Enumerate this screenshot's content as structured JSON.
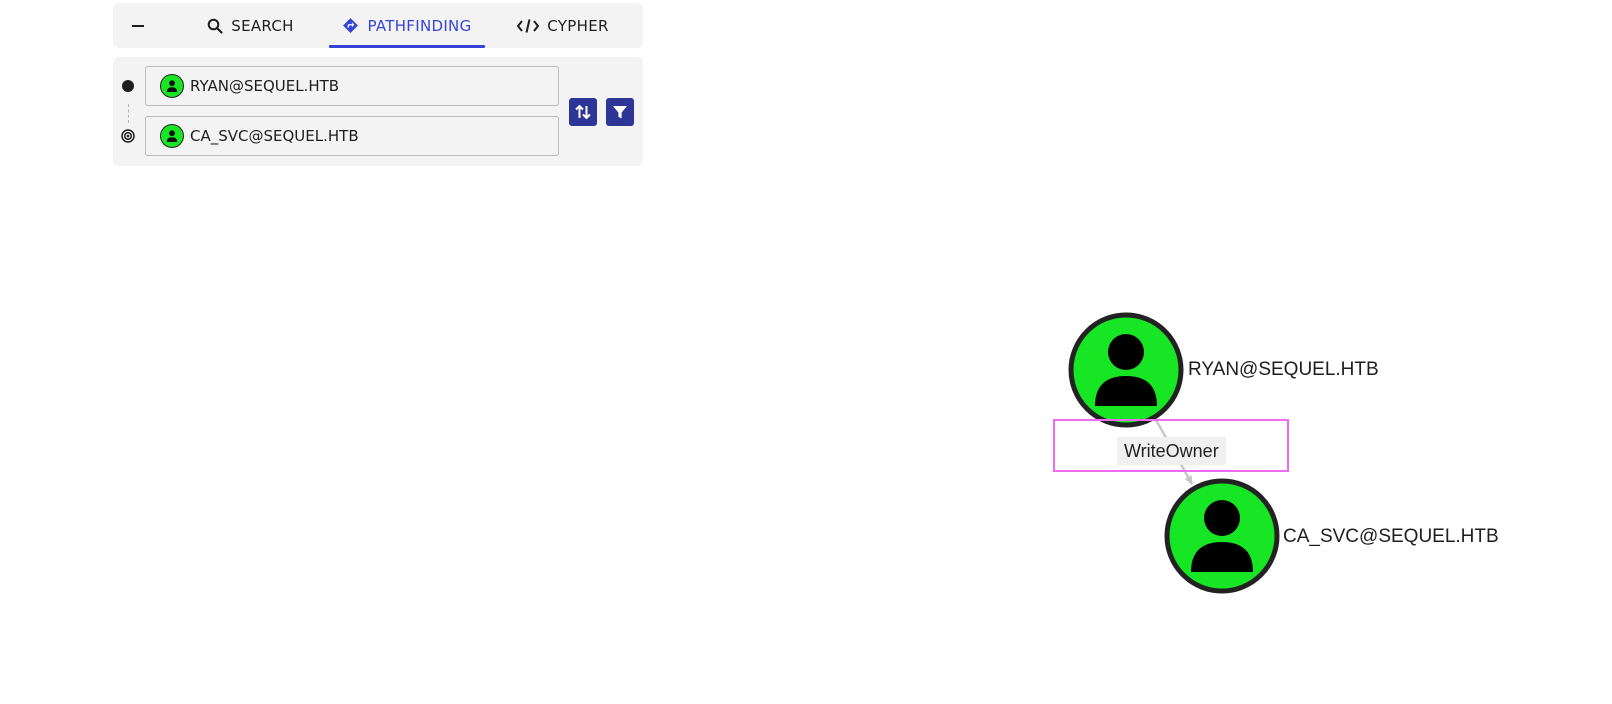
{
  "tabs": {
    "collapse_icon": "minus-icon",
    "search": {
      "label": "SEARCH",
      "icon": "search-icon"
    },
    "pathfinding": {
      "label": "PATHFINDING",
      "icon": "directions-icon",
      "active": true
    },
    "cypher": {
      "label": "CYPHER",
      "icon": "code-icon"
    }
  },
  "pathfinding": {
    "start_node": {
      "value": "RYAN@SEQUEL.HTB",
      "icon": "user-icon"
    },
    "target_node": {
      "value": "CA_SVC@SEQUEL.HTB",
      "icon": "user-icon"
    },
    "swap_icon": "swap-vertical-icon",
    "filter_icon": "filter-icon"
  },
  "graph": {
    "nodes": [
      {
        "id": "ryan",
        "label": "RYAN@SEQUEL.HTB",
        "type": "User"
      },
      {
        "id": "casvc",
        "label": "CA_SVC@SEQUEL.HTB",
        "type": "User"
      }
    ],
    "edges": [
      {
        "source": "ryan",
        "target": "casvc",
        "label": "WriteOwner"
      }
    ]
  },
  "colors": {
    "accent": "#3543d9",
    "button": "#2d3597",
    "user_node": "#17e625",
    "node_border": "#222222",
    "edge_highlight": "#ef6cf0"
  }
}
